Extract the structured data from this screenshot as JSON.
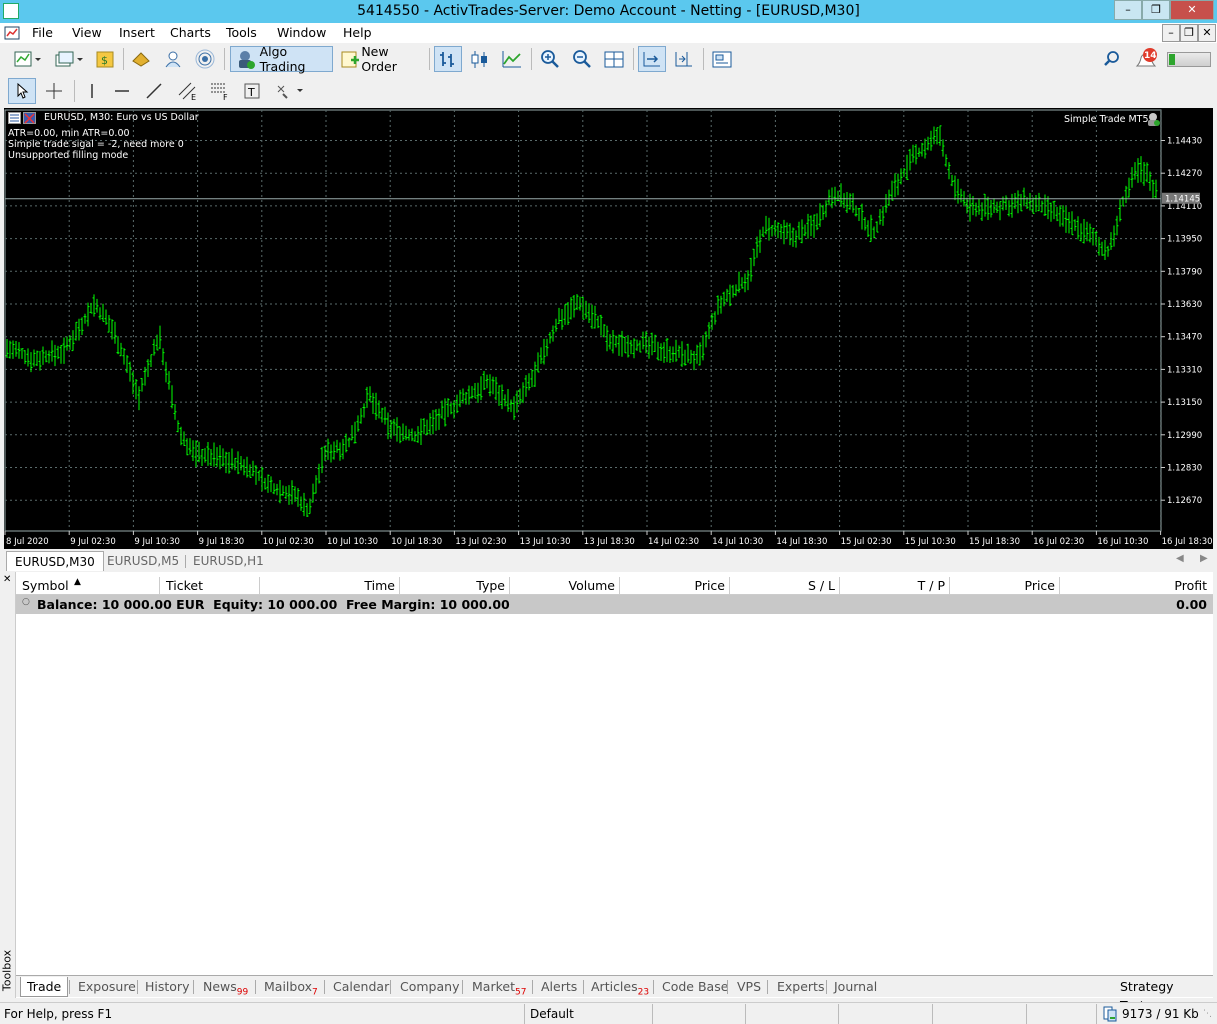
{
  "window": {
    "title": "5414550 - ActivTrades-Server: Demo Account - Netting - [EURUSD,M30]"
  },
  "menu": [
    "File",
    "View",
    "Insert",
    "Charts",
    "Tools",
    "Window",
    "Help"
  ],
  "toolbar": {
    "algo_trading": "Algo Trading",
    "new_order": "New Order",
    "notifications_count": "14"
  },
  "chart": {
    "header": "EURUSD, M30:  Euro vs US Dollar",
    "info_lines": [
      "ATR=0.00, min ATR=0.00",
      "Simple trade sigal = -2, need more 0",
      "Unsupported filling mode"
    ],
    "expert_label": "Simple Trade MT5",
    "current_price": "1.14145",
    "price_ticks": [
      "1.14430",
      "1.14270",
      "1.14110",
      "1.13950",
      "1.13790",
      "1.13630",
      "1.13470",
      "1.13310",
      "1.13150",
      "1.12990",
      "1.12830",
      "1.12670"
    ],
    "time_ticks": [
      "8 Jul 2020",
      "9 Jul 02:30",
      "9 Jul 10:30",
      "9 Jul 18:30",
      "10 Jul 02:30",
      "10 Jul 10:30",
      "10 Jul 18:30",
      "13 Jul 02:30",
      "13 Jul 10:30",
      "13 Jul 18:30",
      "14 Jul 02:30",
      "14 Jul 10:30",
      "14 Jul 18:30",
      "15 Jul 02:30",
      "15 Jul 10:30",
      "15 Jul 18:30",
      "16 Jul 02:30",
      "16 Jul 10:30",
      "16 Jul 18:30"
    ],
    "colors": {
      "background": "#000000",
      "bars": "#00ff00",
      "grid": "#5a6b6b",
      "text": "#ffffff"
    }
  },
  "chart_tabs": [
    "EURUSD,M30",
    "EURUSD,M5",
    "EURUSD,H1"
  ],
  "trade_table": {
    "columns": [
      "Symbol",
      "Ticket",
      "Time",
      "Type",
      "Volume",
      "Price",
      "S / L",
      "T / P",
      "Price",
      "Profit"
    ],
    "balance_line": "Balance: 10 000.00 EUR  Equity: 10 000.00  Free Margin: 10 000.00",
    "profit": "0.00"
  },
  "toolbox_label": "Toolbox",
  "bottom_tabs": [
    {
      "label": "Trade",
      "badge": ""
    },
    {
      "label": "Exposure",
      "badge": ""
    },
    {
      "label": "History",
      "badge": ""
    },
    {
      "label": "News",
      "badge": "99"
    },
    {
      "label": "Mailbox",
      "badge": "7"
    },
    {
      "label": "Calendar",
      "badge": ""
    },
    {
      "label": "Company",
      "badge": ""
    },
    {
      "label": "Market",
      "badge": "57"
    },
    {
      "label": "Alerts",
      "badge": ""
    },
    {
      "label": "Articles",
      "badge": "23"
    },
    {
      "label": "Code Base",
      "badge": ""
    },
    {
      "label": "VPS",
      "badge": ""
    },
    {
      "label": "Experts",
      "badge": ""
    },
    {
      "label": "Journal",
      "badge": ""
    }
  ],
  "strategy_tester": "Strategy Tester",
  "status": {
    "help": "For Help, press F1",
    "profile": "Default",
    "traffic": "9173 / 91 Kb"
  }
}
